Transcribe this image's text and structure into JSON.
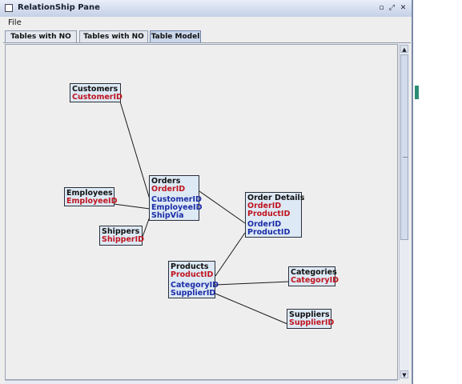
{
  "window": {
    "title": "RelationShip Pane",
    "controls": {
      "minimize": "▫",
      "maximize": "⤢",
      "close": "✕"
    }
  },
  "menu": {
    "file_label": "File"
  },
  "tabs": [
    {
      "label": "Tables with NO PK",
      "active": false
    },
    {
      "label": "Tables with NO FK",
      "active": false
    },
    {
      "label": "Table Model",
      "active": true
    }
  ],
  "tables": {
    "customers": {
      "name": "Customers",
      "pk": [
        "CustomerID"
      ],
      "fk": []
    },
    "employees": {
      "name": "Employees",
      "pk": [
        "EmployeeID"
      ],
      "fk": []
    },
    "shippers": {
      "name": "Shippers",
      "pk": [
        "ShipperID"
      ],
      "fk": []
    },
    "orders": {
      "name": "Orders",
      "pk": [
        "OrderID"
      ],
      "fk": [
        "CustomerID",
        "EmployeeID",
        "ShipVia"
      ]
    },
    "order_details": {
      "name": "Order Details",
      "pk": [
        "OrderID",
        "ProductID"
      ],
      "fk": [
        "OrderID",
        "ProductID"
      ]
    },
    "products": {
      "name": "Products",
      "pk": [
        "ProductID"
      ],
      "fk": [
        "CategoryID",
        "SupplierID"
      ]
    },
    "categories": {
      "name": "Categories",
      "pk": [
        "CategoryID"
      ],
      "fk": []
    },
    "suppliers": {
      "name": "Suppliers",
      "pk": [
        "SupplierID"
      ],
      "fk": []
    }
  },
  "colors": {
    "pk": "#c0141e",
    "fk": "#1b2ca8",
    "box_fill": "#dde9f4",
    "link": "#1a1a1a"
  }
}
